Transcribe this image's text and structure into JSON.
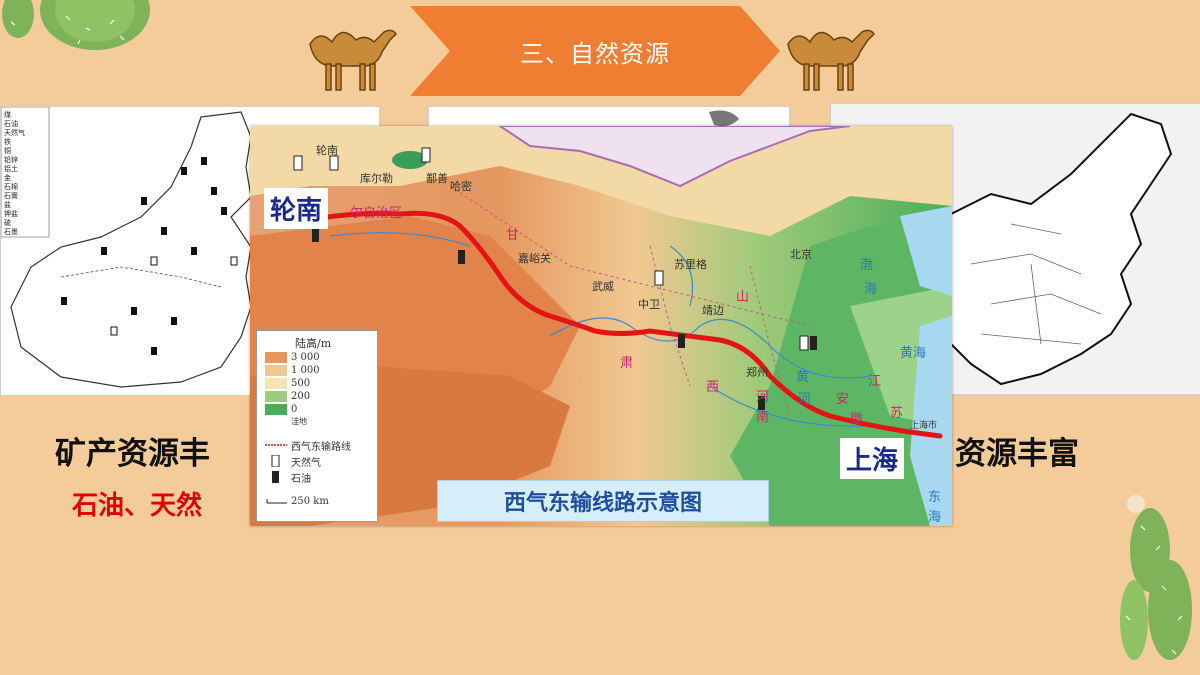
{
  "banner": {
    "title": "三、自然资源",
    "color": "#ef7d32"
  },
  "left_panel": {
    "legend": [
      "煤",
      "石油",
      "天然气",
      "铁",
      "铜",
      "铅锌",
      "铝土",
      "金",
      "石棉",
      "石膏",
      "盐",
      "钾盐",
      "硫",
      "石墨"
    ]
  },
  "headings": {
    "left": "矿产资源丰",
    "right": "资源丰富",
    "left_sub": "石油、天然"
  },
  "map": {
    "title": "西气东输线路示意图",
    "start_label": "轮南",
    "end_label": "上海",
    "route_color": "#e41414",
    "legend": {
      "title": "陆高/m",
      "levels": [
        "3 000",
        "1 000",
        "500",
        "200",
        "0",
        "洼地"
      ],
      "route": "西气东输路线",
      "gas": "天然气",
      "oil": "石油",
      "scale": "250 km"
    },
    "place_labels": [
      "轮南",
      "库尔勒",
      "鄯善",
      "哈密",
      "嘉峪关",
      "武威",
      "苏里格",
      "中卫",
      "靖边",
      "北京",
      "郑州",
      "上海市"
    ],
    "region_labels": [
      "尔自治区",
      "甘",
      "肃",
      "山",
      "西",
      "河",
      "南",
      "江",
      "苏",
      "安",
      "徽"
    ],
    "water_labels": [
      "渤",
      "海",
      "黄海",
      "东",
      "海",
      "黄",
      "河"
    ]
  },
  "colors": {
    "background": "#f4cc9a",
    "heading_red": "#e00000",
    "title_blue": "#1f4e9b"
  }
}
